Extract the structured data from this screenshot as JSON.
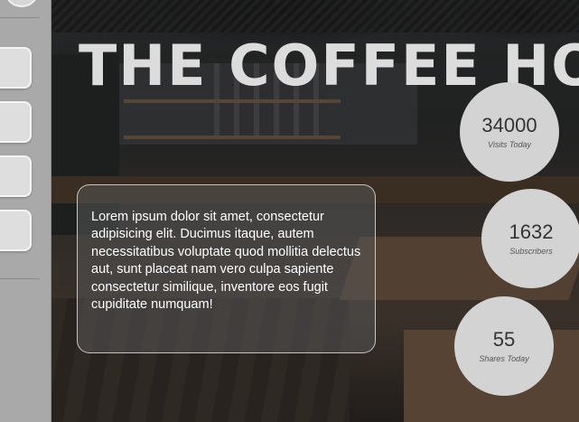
{
  "hero": {
    "title": "THE COFFEE HOU",
    "description": "Lorem ipsum dolor sit amet, consectetur adipisicing elit. Ducimus itaque, autem necessitatibus voluptate quod mollitia delectus aut, sunt placeat nam vero culpa sapiente consectetur similique, inventore eos fugit cupiditate numquam!"
  },
  "stats": [
    {
      "value": "34000",
      "label": "Visits Today"
    },
    {
      "value": "1632",
      "label": "Subscribers"
    },
    {
      "value": "55",
      "label": "Shares Today"
    }
  ],
  "colors": {
    "sidebar": "#a9a9a9",
    "sidebar_button": "#dedede",
    "stat_circle": "#d3d3d3",
    "title": "#dcdcdc"
  }
}
